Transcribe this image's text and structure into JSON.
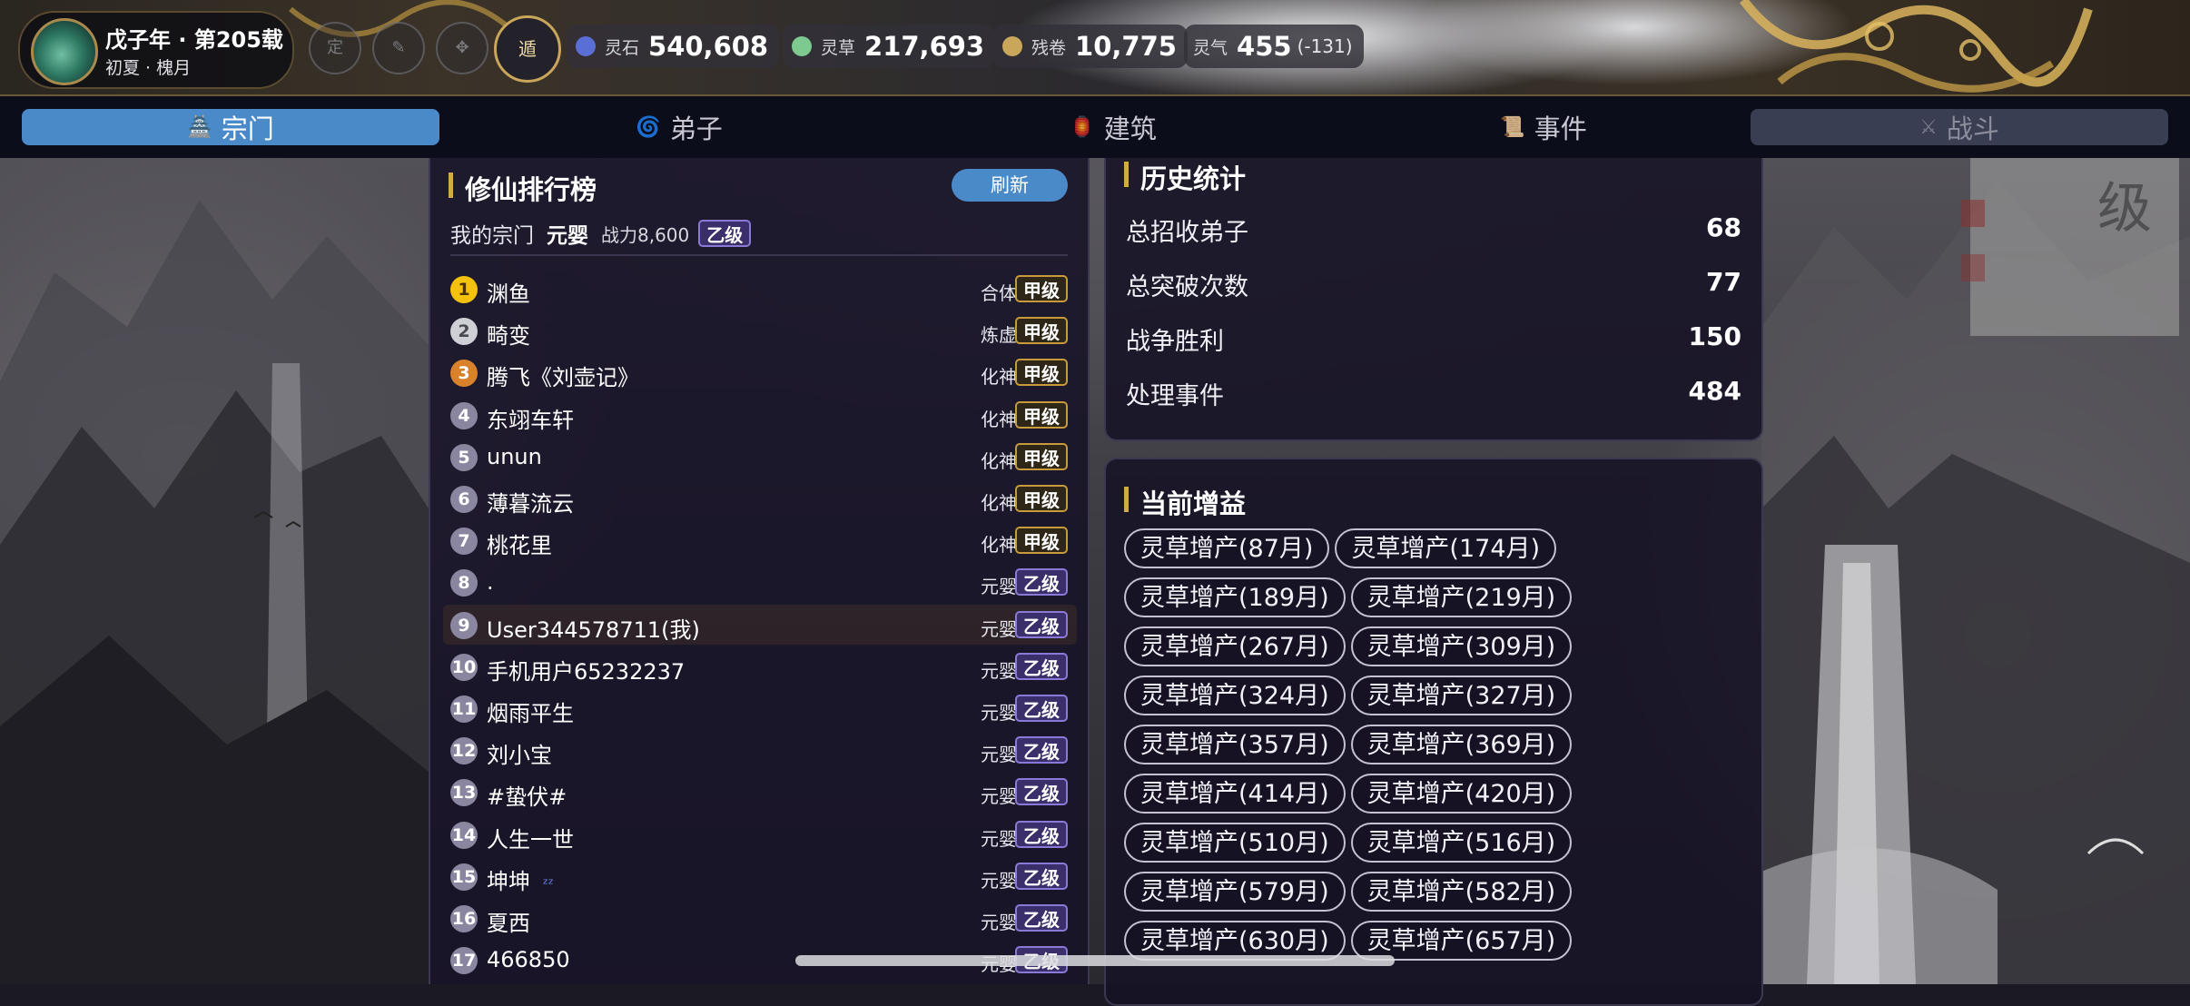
{
  "header": {
    "year_title": "戊子年 · 第205载",
    "season": "初夏 · 槐月",
    "mode_buttons": [
      {
        "label": "定",
        "active": false
      },
      {
        "label": "",
        "active": false
      },
      {
        "label": "",
        "active": false
      },
      {
        "label": "遁",
        "active": true
      }
    ],
    "resources": [
      {
        "label": "灵石",
        "value": "540,608",
        "icon_color": "#5a6fd6"
      },
      {
        "label": "灵草",
        "value": "217,693",
        "icon_color": "#7dc98f"
      },
      {
        "label": "残卷",
        "value": "10,775",
        "icon_color": "#c9a65a"
      },
      {
        "label": "灵气",
        "value": "455",
        "sub": "(-131)"
      }
    ]
  },
  "tabs": [
    {
      "label": "宗门",
      "icon": "🏯",
      "active": true
    },
    {
      "label": "弟子",
      "icon": "🌀",
      "active": false
    },
    {
      "label": "建筑",
      "icon": "🏮",
      "active": false
    },
    {
      "label": "事件",
      "icon": "📜",
      "active": false
    },
    {
      "label": "战斗",
      "icon": "⚔",
      "active": false,
      "disabled": true
    }
  ],
  "ranking": {
    "title": "修仙排行榜",
    "refresh_label": "刷新",
    "my_sect_label": "我的宗门",
    "my_realm": "元婴",
    "my_power": "战力8,600",
    "my_grade": "乙级",
    "rows": [
      {
        "rank": "1",
        "name": "渊鱼",
        "realm": "合体",
        "grade": "甲级"
      },
      {
        "rank": "2",
        "name": "畸变",
        "realm": "炼虚",
        "grade": "甲级"
      },
      {
        "rank": "3",
        "name": "腾飞《刘壶记》",
        "realm": "化神",
        "grade": "甲级"
      },
      {
        "rank": "4",
        "name": "东翊车轩",
        "realm": "化神",
        "grade": "甲级"
      },
      {
        "rank": "5",
        "name": "unun",
        "realm": "化神",
        "grade": "甲级"
      },
      {
        "rank": "6",
        "name": "薄暮流云",
        "realm": "化神",
        "grade": "甲级"
      },
      {
        "rank": "7",
        "name": "桃花里",
        "realm": "化神",
        "grade": "甲级"
      },
      {
        "rank": "8",
        "name": ".",
        "realm": "元婴",
        "grade": "乙级"
      },
      {
        "rank": "9",
        "name": "User344578711(我)",
        "realm": "元婴",
        "grade": "乙级",
        "me": true
      },
      {
        "rank": "10",
        "name": "手机用户65232237",
        "realm": "元婴",
        "grade": "乙级"
      },
      {
        "rank": "11",
        "name": "烟雨平生",
        "realm": "元婴",
        "grade": "乙级"
      },
      {
        "rank": "12",
        "name": "刘小宝",
        "realm": "元婴",
        "grade": "乙级"
      },
      {
        "rank": "13",
        "name": "#蛰伏#",
        "realm": "元婴",
        "grade": "乙级"
      },
      {
        "rank": "14",
        "name": "人生一世",
        "realm": "元婴",
        "grade": "乙级"
      },
      {
        "rank": "15",
        "name": "坤坤",
        "suffix": "ᶻᶻ",
        "realm": "元婴",
        "grade": "乙级"
      },
      {
        "rank": "16",
        "name": "夏西",
        "realm": "元婴",
        "grade": "乙级"
      },
      {
        "rank": "17",
        "name": "466850",
        "realm": "元婴",
        "grade": "乙级"
      }
    ]
  },
  "history": {
    "title": "历史统计",
    "rows": [
      {
        "label": "总招收弟子",
        "value": "68"
      },
      {
        "label": "总突破次数",
        "value": "77"
      },
      {
        "label": "战争胜利",
        "value": "150"
      },
      {
        "label": "处理事件",
        "value": "484"
      }
    ]
  },
  "buffs": {
    "title": "当前增益",
    "items": [
      "灵草增产(87月)",
      "灵草增产(174月)",
      "灵草增产(189月)",
      "灵草增产(219月)",
      "灵草增产(267月)",
      "灵草增产(309月)",
      "灵草增产(324月)",
      "灵草增产(327月)",
      "灵草增产(357月)",
      "灵草增产(369月)",
      "灵草增产(414月)",
      "灵草增产(420月)",
      "灵草增产(510月)",
      "灵草增产(516月)",
      "灵草增产(579月)",
      "灵草增产(582月)",
      "灵草增产(630月)",
      "灵草增产(657月)"
    ]
  },
  "colors": {
    "accent": "#4a8ac9",
    "gold": "#d4aa48",
    "grade_jia": "#c89a3c",
    "grade_yi": "#8b79d8"
  }
}
